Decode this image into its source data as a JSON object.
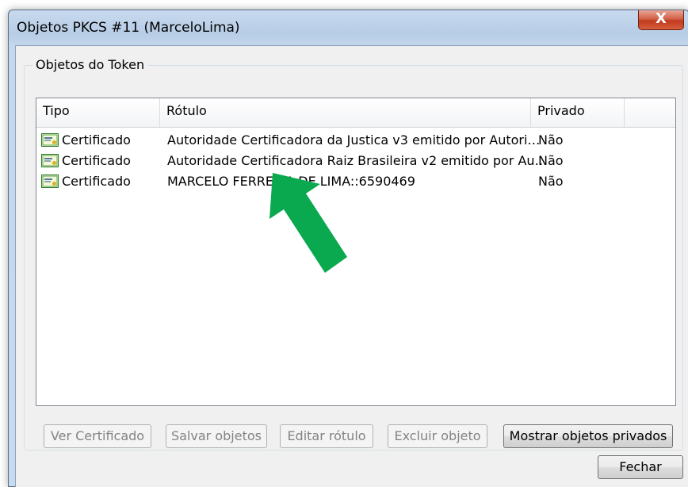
{
  "window": {
    "title": "Objetos PKCS #11 (MarceloLima)",
    "close_label": "X"
  },
  "group": {
    "label": "Objetos do Token"
  },
  "list": {
    "columns": [
      "Tipo",
      "Rótulo",
      "Privado"
    ],
    "rows": [
      {
        "tipo": "Certificado",
        "rotulo": "Autoridade Certificadora da Justica v3 emitido por Autori…",
        "privado": "Não"
      },
      {
        "tipo": "Certificado",
        "rotulo": "Autoridade Certificadora Raiz Brasileira v2 emitido por Au…",
        "privado": "Não"
      },
      {
        "tipo": "Certificado",
        "rotulo": "MARCELO FERREIRA DE LIMA::6590469",
        "privado": "Não"
      }
    ]
  },
  "buttons": {
    "ver_certificado": "Ver Certificado",
    "salvar_objetos": "Salvar objetos",
    "editar_rotulo": "Editar rótulo",
    "excluir_objeto": "Excluir objeto",
    "mostrar_privados": "Mostrar objetos privados",
    "fechar": "Fechar"
  },
  "annotation": {
    "arrow_color": "#0aa84f",
    "icon": "arrow-icon"
  }
}
